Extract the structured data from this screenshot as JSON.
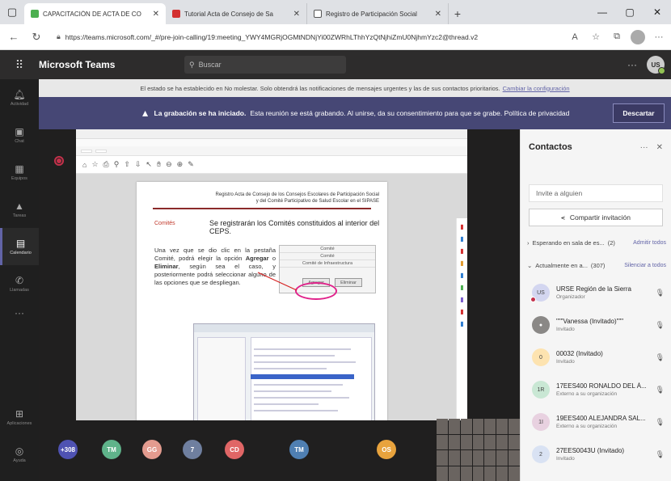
{
  "browser": {
    "tabs": [
      {
        "title": "CAPACITACIÓN DE ACTA DE CO",
        "active": true,
        "color": "#4caf50"
      },
      {
        "title": "Tutorial Acta de Consejo de Sa",
        "active": false,
        "color": "#d32f2f"
      },
      {
        "title": "Registro de Participación Social",
        "active": false,
        "color": "#555555"
      }
    ],
    "url": "https://teams.microsoft.com/_#/pre-join-calling/19:meeting_YWY4MGRjOGMtNDNjYi00ZWRhLThhYzQtNjhiZmU0NjhmYzc2@thread.v2"
  },
  "teams": {
    "app_title": "Microsoft Teams",
    "search_placeholder": "Buscar",
    "user_initials": "US"
  },
  "rail": {
    "items": [
      {
        "label": "Actividad",
        "icon": "bell-icon",
        "glyph": "♫"
      },
      {
        "label": "Chat",
        "icon": "chat-icon",
        "glyph": "▣"
      },
      {
        "label": "Equipos",
        "icon": "teams-icon",
        "glyph": "▦"
      },
      {
        "label": "Tareas",
        "icon": "assignments-icon",
        "glyph": "▲"
      },
      {
        "label": "Calendario",
        "icon": "calendar-icon",
        "glyph": "▤",
        "active": true
      },
      {
        "label": "Llamadas",
        "icon": "phone-icon",
        "glyph": "✆"
      }
    ],
    "more": "···",
    "bottom": [
      {
        "label": "Aplicaciones",
        "icon": "apps-icon",
        "glyph": "⊞"
      },
      {
        "label": "Ayuda",
        "icon": "help-icon",
        "glyph": "◎"
      }
    ]
  },
  "banners": {
    "info_text": "El estado se ha establecido en No molestar. Solo obtendrá las notificaciones de mensajes urgentes y las de sus contactos prioritarios.",
    "info_link": "Cambiar la configuración",
    "recording_bold": "La grabación se ha iniciado.",
    "recording_text": "Esta reunión se está grabando. Al unirse, da su consentimiento para que se grabe. Política de privacidad",
    "dismiss_label": "Descartar"
  },
  "shared": {
    "doc_title_line1": "Registro Acta de Consejo de los Consejos Escolares de Participación Social",
    "doc_title_line2": "y del Comité Participativo de Salud Escolar en el SIPASE",
    "section_label": "Comités",
    "section_heading": "Se registrarán los Comités constituidos al interior del CEPS.",
    "para_pre": "Una vez que se dio clic en la pestaña Comité, podrá elegir la opción",
    "para_bold1": "Agregar",
    "para_mid": "o",
    "para_bold2": "Eliminar",
    "para_post": ", según sea el caso, y posteriormente podrá seleccionar alguno de las opciones que se despliegan.",
    "dialog_row1": "Comité",
    "dialog_row2": "Comité",
    "dialog_row3": "Comité de Infraestructura",
    "btn_agregar": "Agregar",
    "btn_eliminar": "Eliminar"
  },
  "participants": {
    "tiles": [
      {
        "label": "+308",
        "color": "#4f52b2"
      },
      {
        "label": "TM",
        "color": "#5fb38a"
      },
      {
        "label": "GG",
        "color": "#e39b8f"
      },
      {
        "label": "7",
        "color": "#6f7f9f"
      },
      {
        "label": "CD",
        "color": "#e06666"
      },
      {
        "label": "TM",
        "color": "#4f7fb2"
      },
      {
        "label": "OS",
        "color": "#e8a33d"
      }
    ]
  },
  "contacts_panel": {
    "title": "Contactos",
    "invite_placeholder": "Invite a alguien",
    "share_label": "Compartir invitación",
    "waiting": {
      "label": "Esperando en sala de es...",
      "count": "(2)",
      "action": "Admitir todos"
    },
    "current": {
      "label": "Actualmente en a...",
      "count": "(307)",
      "action": "Silenciar a todos"
    },
    "people": [
      {
        "initials": "US",
        "name": "URSE Región de la Sierra",
        "role": "Organizador",
        "color": "#d3d6f0",
        "recording": true
      },
      {
        "initials": "",
        "name": "\"\"\"Vanessa (Invitado)\"\"\"",
        "role": "Invitado",
        "color": "#8a8886",
        "recording": false
      },
      {
        "initials": "0",
        "name": "00032 (Invitado)",
        "role": "Invitado",
        "color": "#fde3b0",
        "recording": false
      },
      {
        "initials": "1R",
        "name": "17EES400 RONALDO DEL Á...",
        "role": "Externo a su organización",
        "color": "#c9e7d4",
        "recording": false
      },
      {
        "initials": "1I",
        "name": "19EES400 ALEJANDRA SAL...",
        "role": "Externo a su organización",
        "color": "#e8d1e0",
        "recording": false
      },
      {
        "initials": "2",
        "name": "27EES0043U (Invitado)",
        "role": "Invitado",
        "color": "#d9e2f3",
        "recording": false
      }
    ]
  }
}
